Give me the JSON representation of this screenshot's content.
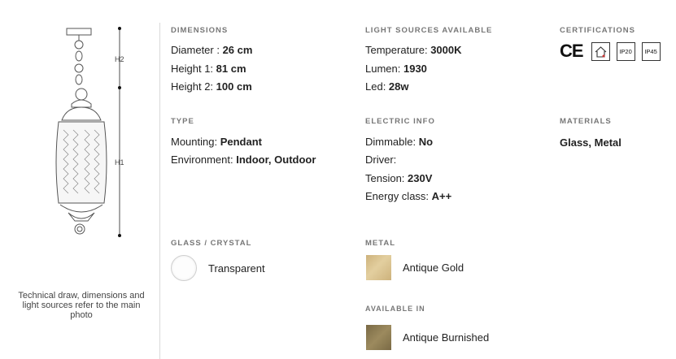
{
  "drawing": {
    "h2_label": "H2",
    "h1_label": "H1",
    "caption": "Technical draw, dimensions and light sources refer to the main photo"
  },
  "dimensions": {
    "title": "DIMENSIONS",
    "diameter_label": "Diameter : ",
    "diameter_value": "26 cm",
    "height1_label": "Height 1: ",
    "height1_value": "81 cm",
    "height2_label": "Height 2: ",
    "height2_value": "100 cm"
  },
  "light_sources": {
    "title": "LIGHT SOURCES AVAILABLE",
    "temperature_label": "Temperature: ",
    "temperature_value": "3000K",
    "lumen_label": "Lumen: ",
    "lumen_value": "1930",
    "led_label": "Led: ",
    "led_value": "28w"
  },
  "certifications": {
    "title": "CERTIFICATIONS",
    "ce": "CE",
    "ip20": "IP20",
    "ip45": "IP45"
  },
  "type": {
    "title": "TYPE",
    "mounting_label": "Mounting: ",
    "mounting_value": "Pendant",
    "environment_label": "Environment: ",
    "environment_value": "Indoor, Outdoor"
  },
  "electric": {
    "title": "ELECTRIC INFO",
    "dimmable_label": "Dimmable: ",
    "dimmable_value": "No",
    "driver_label": "Driver:",
    "tension_label": "Tension: ",
    "tension_value": "230V",
    "energy_label": "Energy class: ",
    "energy_value": "A++"
  },
  "materials": {
    "title": "MATERIALS",
    "value": "Glass, Metal"
  },
  "glass": {
    "title": "GLASS / CRYSTAL",
    "option": "Transparent"
  },
  "metal": {
    "title": "METAL",
    "option": "Antique Gold",
    "available_title": "AVAILABLE IN",
    "available_option": "Antique Burnished"
  },
  "colors": {
    "antique_gold": "#cdb27c",
    "antique_burnished": "#7a6a45"
  }
}
